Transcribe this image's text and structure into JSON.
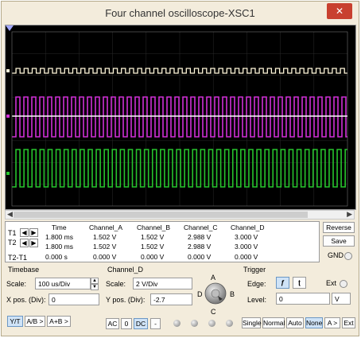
{
  "window": {
    "title": "Four channel oscilloscope-XSC1",
    "close_glyph": "✕"
  },
  "scope_screen": {
    "background": "#000000",
    "channels": [
      {
        "name": "Channel_A",
        "color": "#fff7d9",
        "shape": "square"
      },
      {
        "name": "Channel_B",
        "color": "#d02fd6",
        "shape": "square"
      },
      {
        "name": "Channel_C",
        "color": "#ffffff",
        "shape": "flat"
      },
      {
        "name": "Channel_D",
        "color": "#27c42d",
        "shape": "square"
      }
    ]
  },
  "readout": {
    "row_labels": [
      "T1",
      "T2",
      "T2-T1"
    ],
    "columns": [
      "Time",
      "Channel_A",
      "Channel_B",
      "Channel_C",
      "Channel_D"
    ],
    "rows": [
      [
        "1.800 ms",
        "1.502 V",
        "1.502 V",
        "2.988 V",
        "3.000 V"
      ],
      [
        "1.800 ms",
        "1.502 V",
        "1.502 V",
        "2.988 V",
        "3.000 V"
      ],
      [
        "0.000 s",
        "0.000 V",
        "0.000 V",
        "0.000 V",
        "0.000 V"
      ]
    ],
    "reverse_label": "Reverse",
    "save_label": "Save",
    "gnd_label": "GND"
  },
  "timebase": {
    "title": "Timebase",
    "scale_label": "Scale:",
    "scale_value": "100 us/Div",
    "xpos_label": "X pos. (Div):",
    "xpos_value": "0",
    "buttons": [
      "Y/T",
      "A/B >",
      "A+B >"
    ]
  },
  "channel": {
    "title": "Channel_D",
    "scale_label": "Scale:",
    "scale_value": "2  V/Div",
    "ypos_label": "Y pos. (Div):",
    "ypos_value": "-2.7",
    "knob_labels": [
      "A",
      "B",
      "C",
      "D"
    ],
    "coupling_buttons": [
      "AC",
      "0",
      "DC",
      "-"
    ]
  },
  "trigger": {
    "title": "Trigger",
    "edge_label": "Edge:",
    "rise_glyph": "ƒ",
    "fall_glyph": "ʈ",
    "ext_label": "Ext",
    "level_label": "Level:",
    "level_value": "0",
    "level_unit": "V",
    "mode_buttons": [
      "Single",
      "Normal",
      "Auto",
      "None",
      "A >",
      "Ext"
    ]
  }
}
